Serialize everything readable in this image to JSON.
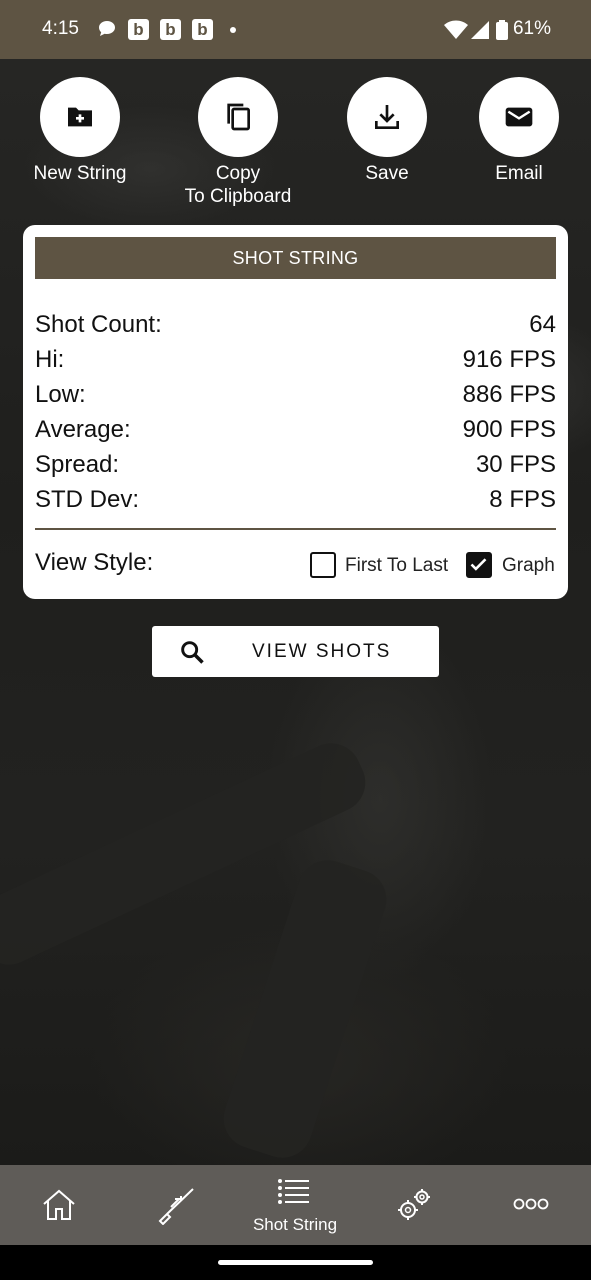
{
  "status_bar": {
    "time": "4:15",
    "notif_b": [
      "b",
      "b",
      "b"
    ],
    "battery": "61%"
  },
  "actions": [
    {
      "label": "New String",
      "icon": "folder-add-icon"
    },
    {
      "label": "Copy\nTo Clipboard",
      "icon": "copy-icon"
    },
    {
      "label": "Save",
      "icon": "download-icon"
    },
    {
      "label": "Email",
      "icon": "mail-icon"
    }
  ],
  "card": {
    "header": "SHOT STRING",
    "stats": [
      {
        "label": "Shot Count:",
        "value": "64"
      },
      {
        "label": "Hi:",
        "value": "916 FPS"
      },
      {
        "label": "Low:",
        "value": "886 FPS"
      },
      {
        "label": "Average:",
        "value": "900 FPS"
      },
      {
        "label": "Spread:",
        "value": "30 FPS"
      },
      {
        "label": "STD Dev:",
        "value": "8 FPS"
      }
    ],
    "view_style_label": "View Style:",
    "options": [
      {
        "label": "First To Last",
        "checked": false
      },
      {
        "label": "Graph",
        "checked": true
      }
    ]
  },
  "view_shots_label": "VIEW SHOTS",
  "nav": {
    "items": [
      {
        "icon": "home-icon",
        "label": ""
      },
      {
        "icon": "rifle-icon",
        "label": ""
      },
      {
        "icon": "list-icon",
        "label": "Shot String"
      },
      {
        "icon": "gears-icon",
        "label": ""
      },
      {
        "icon": "more-icon",
        "label": ""
      }
    ]
  },
  "colors": {
    "accent": "#5e5443",
    "nav_bg": "#5f5c58"
  }
}
